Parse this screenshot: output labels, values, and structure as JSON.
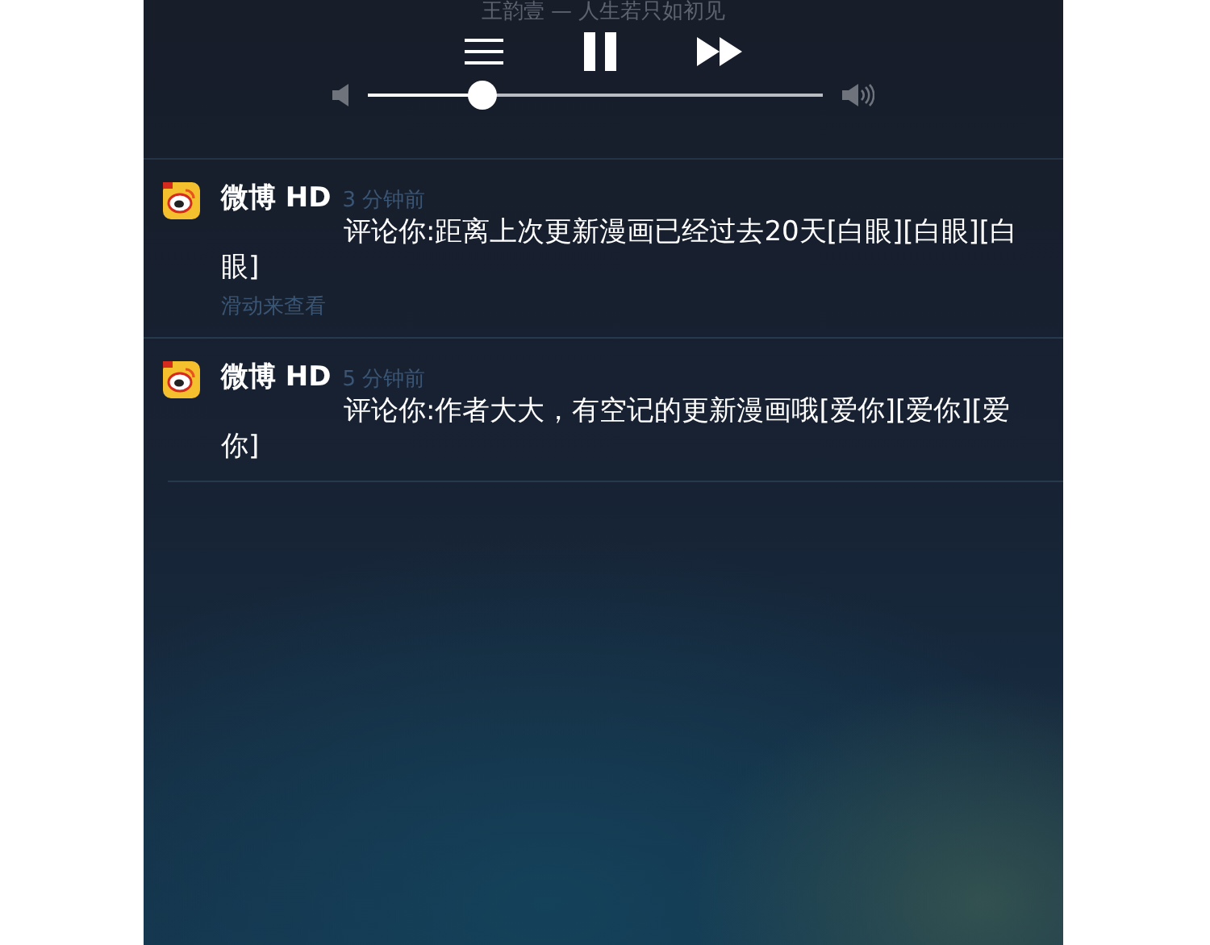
{
  "now_playing": {
    "song": "王韵壹 — 人生若只如初见"
  },
  "volume": {
    "level": 0.25
  },
  "notifications": [
    {
      "app": "微博 HD",
      "time": "3 分钟前",
      "body": "评论你:距离上次更新漫画已经过去20天[白眼][白眼][白眼]",
      "hint": "滑动来查看"
    },
    {
      "app": "微博 HD",
      "time": "5 分钟前",
      "body": "评论你:作者大大，有空记的更新漫画哦[爱你][爱你][爱你]"
    }
  ]
}
